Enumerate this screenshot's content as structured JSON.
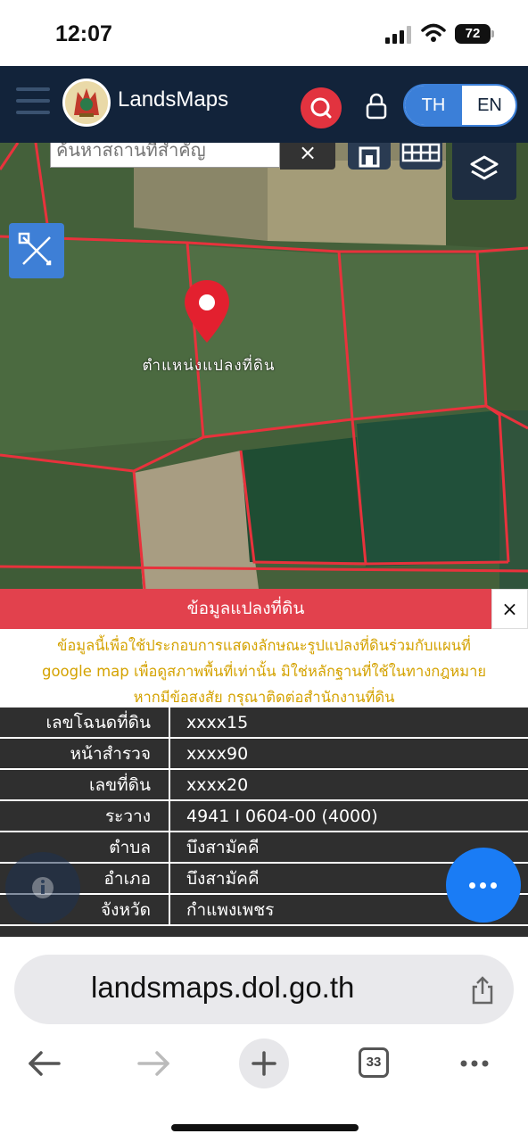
{
  "status": {
    "time": "12:07",
    "battery": "72"
  },
  "header": {
    "brand": "LandsMaps",
    "lang_th": "TH",
    "lang_en": "EN"
  },
  "map": {
    "search_placeholder": "ค้นหาสถานที่สำคัญ",
    "clear_label": "×",
    "parcel_label": "ตำแหน่งแปลงที่ดิน"
  },
  "panel": {
    "title": "ข้อมูลแปลงที่ดิน",
    "close_label": "×",
    "notice": [
      "ข้อมูลนี้เพื่อใช้ประกอบการแสดงลักษณะรูปแปลงที่ดินร่วมกับแผนที่",
      "google map เพื่อดูสภาพพื้นที่เท่านั้น มิใช่หลักฐานที่ใช้ในทางกฎหมาย",
      "หากมีข้อสงสัย กรุณาติดต่อสำนักงานที่ดิน"
    ],
    "rows": [
      {
        "key": "เลขโฉนดที่ดิน",
        "value": "xxxx15"
      },
      {
        "key": "หน้าสำรวจ",
        "value": "xxxx90"
      },
      {
        "key": "เลขที่ดิน",
        "value": "xxxx20"
      },
      {
        "key": "ระวาง",
        "value": "4941 I 0604-00 (4000)"
      },
      {
        "key": "ตำบล",
        "value": "บึงสามัคคี"
      },
      {
        "key": "อำเภอ",
        "value": "บึงสามัคคี"
      },
      {
        "key": "จังหวัด",
        "value": "กำแพงเพชร"
      }
    ]
  },
  "browser": {
    "url": "landsmaps.dol.go.th",
    "tab_count": "33"
  }
}
